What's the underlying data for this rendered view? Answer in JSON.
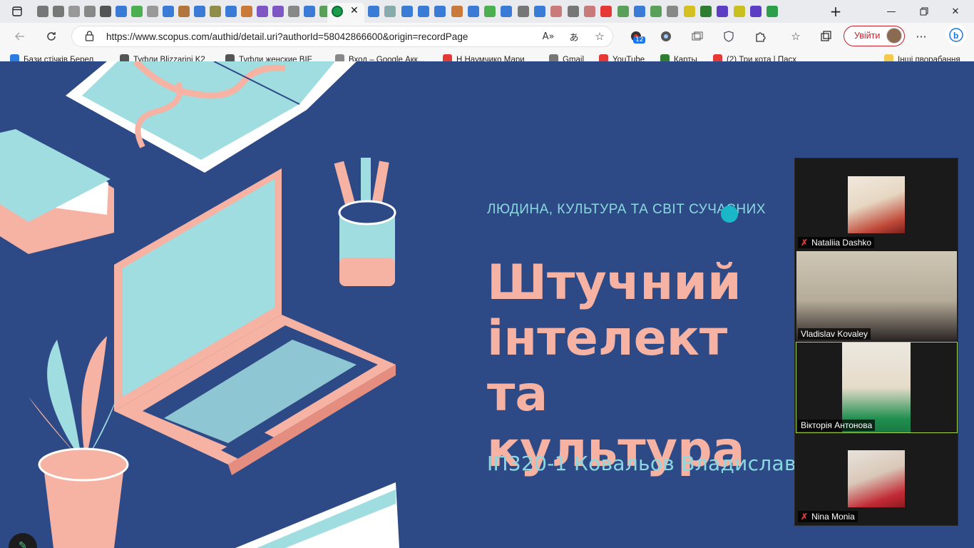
{
  "browser": {
    "url": "https://www.scopus.com/authid/detail.uri?authorId=58042866600&origin=recordPage",
    "signin_label": "Увійти",
    "extension_badge": "12",
    "bookmarks": [
      {
        "label": "Бази стічків Берел",
        "color": "#2b7be0"
      },
      {
        "label": "Туфли Blizzarini K2",
        "color": "#555555"
      },
      {
        "label": "Туфли женские BIF",
        "color": "#555555"
      },
      {
        "label": "Вход – Google Акк...",
        "color": "#888888"
      },
      {
        "label": "Н Наумчико Мари",
        "color": "#e53935"
      },
      {
        "label": "Gmail",
        "color": "#777777"
      },
      {
        "label": "YouTube",
        "color": "#e53935"
      },
      {
        "label": "Карты",
        "color": "#2e7d32"
      },
      {
        "label": "(2) Три кота | Пасх",
        "color": "#e53935"
      }
    ],
    "other_bookmarks": "Інші пворабання"
  },
  "slide": {
    "subtitle": "ЛЮДИНА, КУЛЬТУРА ТА СВІТ СУЧАСНИХ",
    "title": "Штучний інтелект та культура",
    "author": "ІП320-1 Ковальов Владислав"
  },
  "participants": [
    {
      "name": "Nataliia Dashko",
      "muted": true
    },
    {
      "name": "Vladislav Kovaley",
      "muted": false
    },
    {
      "name": "Вікторія Антонова",
      "muted": false,
      "talking": true
    },
    {
      "name": "Nina Monia",
      "muted": true
    }
  ],
  "colors": {
    "slide_bg": "#2e4a86",
    "title": "#f6b3a3",
    "subtitle": "#8ad8e0",
    "accent_teal": "#19b7c7",
    "signin": "#c5222c"
  },
  "icons": {
    "back": "arrow-left-icon",
    "refresh": "refresh-icon",
    "lock": "lock-icon",
    "favorite": "star-icon",
    "menu": "more-icon"
  }
}
